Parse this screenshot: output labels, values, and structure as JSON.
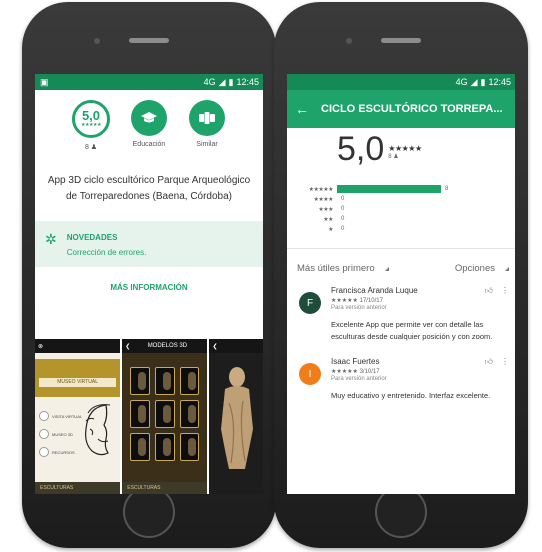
{
  "left_phone": {
    "status": {
      "time": "12:45",
      "network": "4G"
    },
    "stats": [
      {
        "label": "8 ♟",
        "kind": "rating",
        "value": "5,0",
        "stars": "★★★★★"
      },
      {
        "label": "Educación",
        "kind": "category",
        "icon": "graduation-cap-icon"
      },
      {
        "label": "Similar",
        "kind": "similar",
        "icon": "similar-apps-icon"
      }
    ],
    "description": "App 3D ciclo escultórico Parque Arqueológico de Torreparedones (Baena, Córdoba)",
    "news": {
      "title": "NOVEDADES",
      "body": "Corrección de errores."
    },
    "more_info": "MÁS INFORMACIÓN",
    "screenshots": {
      "museo_title": "MUSEO VIRTUAL",
      "menu": [
        "VISITA VIRTUAL",
        "MUSEO 3D",
        "RECURSOS"
      ],
      "modelos_title": "MODELOS 3D",
      "footer": "ESCULTURAS"
    }
  },
  "right_phone": {
    "status": {
      "time": "12:45",
      "network": "4G"
    },
    "app_title": "CICLO ESCULTÓRICO TORREPA...",
    "rating": {
      "value": "5,0",
      "stars": "★★★★★",
      "count": "8 ♟"
    },
    "histogram": [
      {
        "stars": "★★★★★",
        "count": "8",
        "fraction": 1.0
      },
      {
        "stars": "★★★★",
        "count": "0",
        "fraction": 0
      },
      {
        "stars": "★★★",
        "count": "0",
        "fraction": 0
      },
      {
        "stars": "★★",
        "count": "0",
        "fraction": 0
      },
      {
        "stars": "★",
        "count": "0",
        "fraction": 0
      }
    ],
    "sort": {
      "label": "Más útiles primero",
      "options": "Opciones"
    },
    "reviews": [
      {
        "initial": "F",
        "color": "#1f4d3a",
        "name": "Francisca Aranda Luque",
        "stars": "★★★★★",
        "date": "17/10/17",
        "version": "Para versión anterior",
        "text": "Excelente App que permite ver con detalle las esculturas desde cualquier posición y con zoom."
      },
      {
        "initial": "I",
        "color": "#f07d1a",
        "name": "Isaac Fuertes",
        "stars": "★★★★★",
        "date": "3/10/17",
        "version": "Para versión anterior",
        "text": "Muy educativo y entretenido. Interfaz excelente."
      }
    ]
  }
}
